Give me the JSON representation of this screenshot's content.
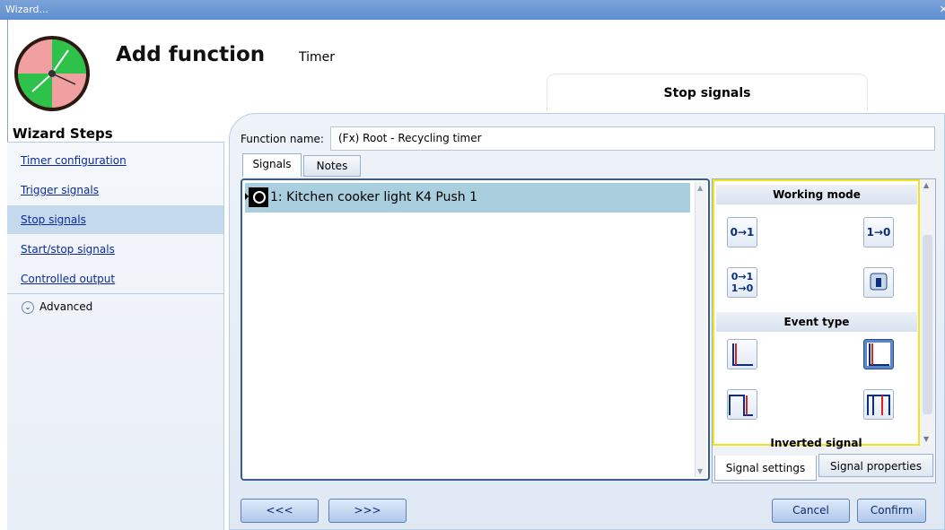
{
  "window": {
    "title": "Wizard..."
  },
  "header": {
    "title": "Add function",
    "subtitle": "Timer",
    "section_tab": "Stop signals"
  },
  "wizard_steps": {
    "heading": "Wizard Steps",
    "items": [
      {
        "label": "Timer configuration",
        "selected": false
      },
      {
        "label": "Trigger signals",
        "selected": false
      },
      {
        "label": "Stop signals",
        "selected": true
      },
      {
        "label": "Start/stop signals",
        "selected": false
      },
      {
        "label": "Controlled output",
        "selected": false
      }
    ],
    "advanced_label": "Advanced"
  },
  "form": {
    "function_name_label": "Function name:",
    "function_name_value": "(Fx) Root - Recycling timer"
  },
  "tabs": [
    {
      "label": "Signals",
      "active": true
    },
    {
      "label": "Notes",
      "active": false
    }
  ],
  "signals_list": [
    {
      "label": "1: Kitchen cooker light K4 Push 1",
      "selected": true
    }
  ],
  "properties": {
    "working_mode_label": "Working mode",
    "working_mode_options": [
      {
        "label": "0→1",
        "selected": false
      },
      {
        "label": "1→0",
        "selected": false
      },
      {
        "label": "0→1 1→0",
        "selected": false
      },
      {
        "label": "switch",
        "selected": false
      }
    ],
    "event_type_label": "Event type",
    "event_type_options": [
      {
        "icon": "pulse-falling-edge-icon",
        "selected": false
      },
      {
        "icon": "pulse-falling-edge-selected-icon",
        "selected": true
      },
      {
        "icon": "pulse-rising-edge-icon",
        "selected": false
      },
      {
        "icon": "pulse-double-edge-icon",
        "selected": false
      }
    ],
    "inverted_signal_label": "Inverted signal",
    "tabs": [
      {
        "label": "Signal settings",
        "active": true
      },
      {
        "label": "Signal properties",
        "active": false
      }
    ]
  },
  "buttons": {
    "prev": "<<<",
    "next": ">>>",
    "cancel": "Cancel",
    "confirm": "Confirm"
  },
  "colors": {
    "highlight": "#f2e31b",
    "selected_row": "#a9cfde",
    "link": "#0b2a9c"
  }
}
